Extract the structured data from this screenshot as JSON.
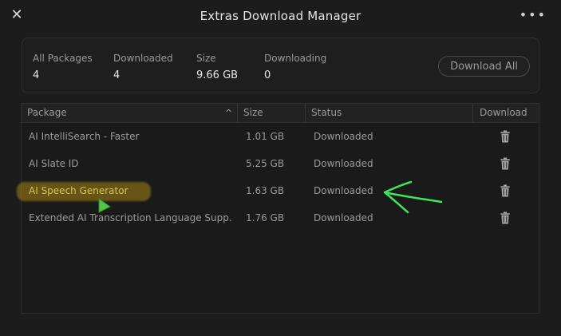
{
  "window": {
    "title": "Extras Download Manager",
    "close_icon": "close-icon",
    "more_icon": "more-options-icon"
  },
  "summary": {
    "all_packages_label": "All Packages",
    "all_packages_value": "4",
    "downloaded_label": "Downloaded",
    "downloaded_value": "4",
    "size_label": "Size",
    "size_value": "9.66 GB",
    "downloading_label": "Downloading",
    "downloading_value": "0",
    "download_all_label": "Download All"
  },
  "table": {
    "headers": {
      "package": "Package",
      "size": "Size",
      "status": "Status",
      "download": "Download"
    },
    "rows": [
      {
        "name": "AI IntelliSearch - Faster",
        "size": "1.01 GB",
        "status": "Downloaded"
      },
      {
        "name": "AI Slate ID",
        "size": "5.25 GB",
        "status": "Downloaded"
      },
      {
        "name": "AI Speech Generator",
        "size": "1.63 GB",
        "status": "Downloaded"
      },
      {
        "name": "Extended AI Transcription Language Supp...",
        "size": "1.76 GB",
        "status": "Downloaded"
      }
    ]
  },
  "annotations": {
    "highlight_color": "#a58714",
    "arrow_color": "#3ee65a"
  }
}
